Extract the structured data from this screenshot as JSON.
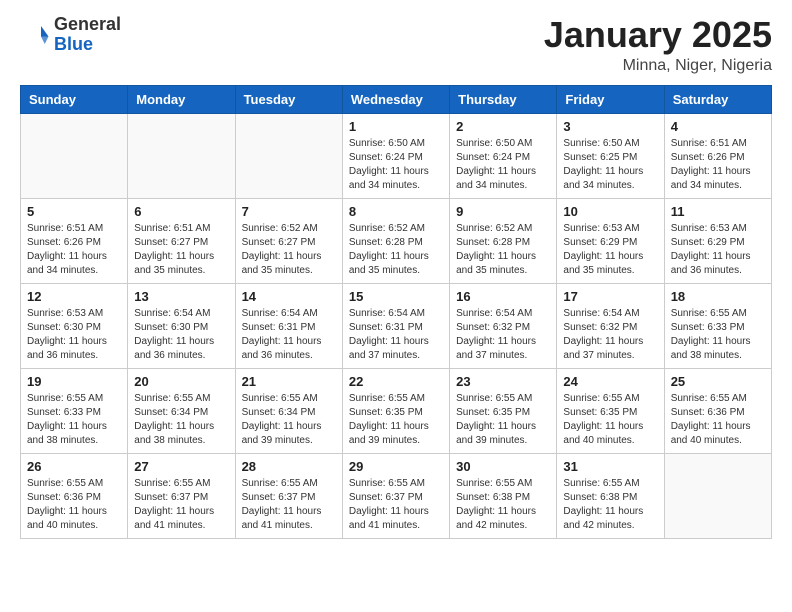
{
  "header": {
    "logo_general": "General",
    "logo_blue": "Blue",
    "title": "January 2025",
    "location": "Minna, Niger, Nigeria"
  },
  "days_of_week": [
    "Sunday",
    "Monday",
    "Tuesday",
    "Wednesday",
    "Thursday",
    "Friday",
    "Saturday"
  ],
  "weeks": [
    [
      {
        "day": "",
        "info": ""
      },
      {
        "day": "",
        "info": ""
      },
      {
        "day": "",
        "info": ""
      },
      {
        "day": "1",
        "info": "Sunrise: 6:50 AM\nSunset: 6:24 PM\nDaylight: 11 hours\nand 34 minutes."
      },
      {
        "day": "2",
        "info": "Sunrise: 6:50 AM\nSunset: 6:24 PM\nDaylight: 11 hours\nand 34 minutes."
      },
      {
        "day": "3",
        "info": "Sunrise: 6:50 AM\nSunset: 6:25 PM\nDaylight: 11 hours\nand 34 minutes."
      },
      {
        "day": "4",
        "info": "Sunrise: 6:51 AM\nSunset: 6:26 PM\nDaylight: 11 hours\nand 34 minutes."
      }
    ],
    [
      {
        "day": "5",
        "info": "Sunrise: 6:51 AM\nSunset: 6:26 PM\nDaylight: 11 hours\nand 34 minutes."
      },
      {
        "day": "6",
        "info": "Sunrise: 6:51 AM\nSunset: 6:27 PM\nDaylight: 11 hours\nand 35 minutes."
      },
      {
        "day": "7",
        "info": "Sunrise: 6:52 AM\nSunset: 6:27 PM\nDaylight: 11 hours\nand 35 minutes."
      },
      {
        "day": "8",
        "info": "Sunrise: 6:52 AM\nSunset: 6:28 PM\nDaylight: 11 hours\nand 35 minutes."
      },
      {
        "day": "9",
        "info": "Sunrise: 6:52 AM\nSunset: 6:28 PM\nDaylight: 11 hours\nand 35 minutes."
      },
      {
        "day": "10",
        "info": "Sunrise: 6:53 AM\nSunset: 6:29 PM\nDaylight: 11 hours\nand 35 minutes."
      },
      {
        "day": "11",
        "info": "Sunrise: 6:53 AM\nSunset: 6:29 PM\nDaylight: 11 hours\nand 36 minutes."
      }
    ],
    [
      {
        "day": "12",
        "info": "Sunrise: 6:53 AM\nSunset: 6:30 PM\nDaylight: 11 hours\nand 36 minutes."
      },
      {
        "day": "13",
        "info": "Sunrise: 6:54 AM\nSunset: 6:30 PM\nDaylight: 11 hours\nand 36 minutes."
      },
      {
        "day": "14",
        "info": "Sunrise: 6:54 AM\nSunset: 6:31 PM\nDaylight: 11 hours\nand 36 minutes."
      },
      {
        "day": "15",
        "info": "Sunrise: 6:54 AM\nSunset: 6:31 PM\nDaylight: 11 hours\nand 37 minutes."
      },
      {
        "day": "16",
        "info": "Sunrise: 6:54 AM\nSunset: 6:32 PM\nDaylight: 11 hours\nand 37 minutes."
      },
      {
        "day": "17",
        "info": "Sunrise: 6:54 AM\nSunset: 6:32 PM\nDaylight: 11 hours\nand 37 minutes."
      },
      {
        "day": "18",
        "info": "Sunrise: 6:55 AM\nSunset: 6:33 PM\nDaylight: 11 hours\nand 38 minutes."
      }
    ],
    [
      {
        "day": "19",
        "info": "Sunrise: 6:55 AM\nSunset: 6:33 PM\nDaylight: 11 hours\nand 38 minutes."
      },
      {
        "day": "20",
        "info": "Sunrise: 6:55 AM\nSunset: 6:34 PM\nDaylight: 11 hours\nand 38 minutes."
      },
      {
        "day": "21",
        "info": "Sunrise: 6:55 AM\nSunset: 6:34 PM\nDaylight: 11 hours\nand 39 minutes."
      },
      {
        "day": "22",
        "info": "Sunrise: 6:55 AM\nSunset: 6:35 PM\nDaylight: 11 hours\nand 39 minutes."
      },
      {
        "day": "23",
        "info": "Sunrise: 6:55 AM\nSunset: 6:35 PM\nDaylight: 11 hours\nand 39 minutes."
      },
      {
        "day": "24",
        "info": "Sunrise: 6:55 AM\nSunset: 6:35 PM\nDaylight: 11 hours\nand 40 minutes."
      },
      {
        "day": "25",
        "info": "Sunrise: 6:55 AM\nSunset: 6:36 PM\nDaylight: 11 hours\nand 40 minutes."
      }
    ],
    [
      {
        "day": "26",
        "info": "Sunrise: 6:55 AM\nSunset: 6:36 PM\nDaylight: 11 hours\nand 40 minutes."
      },
      {
        "day": "27",
        "info": "Sunrise: 6:55 AM\nSunset: 6:37 PM\nDaylight: 11 hours\nand 41 minutes."
      },
      {
        "day": "28",
        "info": "Sunrise: 6:55 AM\nSunset: 6:37 PM\nDaylight: 11 hours\nand 41 minutes."
      },
      {
        "day": "29",
        "info": "Sunrise: 6:55 AM\nSunset: 6:37 PM\nDaylight: 11 hours\nand 41 minutes."
      },
      {
        "day": "30",
        "info": "Sunrise: 6:55 AM\nSunset: 6:38 PM\nDaylight: 11 hours\nand 42 minutes."
      },
      {
        "day": "31",
        "info": "Sunrise: 6:55 AM\nSunset: 6:38 PM\nDaylight: 11 hours\nand 42 minutes."
      },
      {
        "day": "",
        "info": ""
      }
    ]
  ]
}
